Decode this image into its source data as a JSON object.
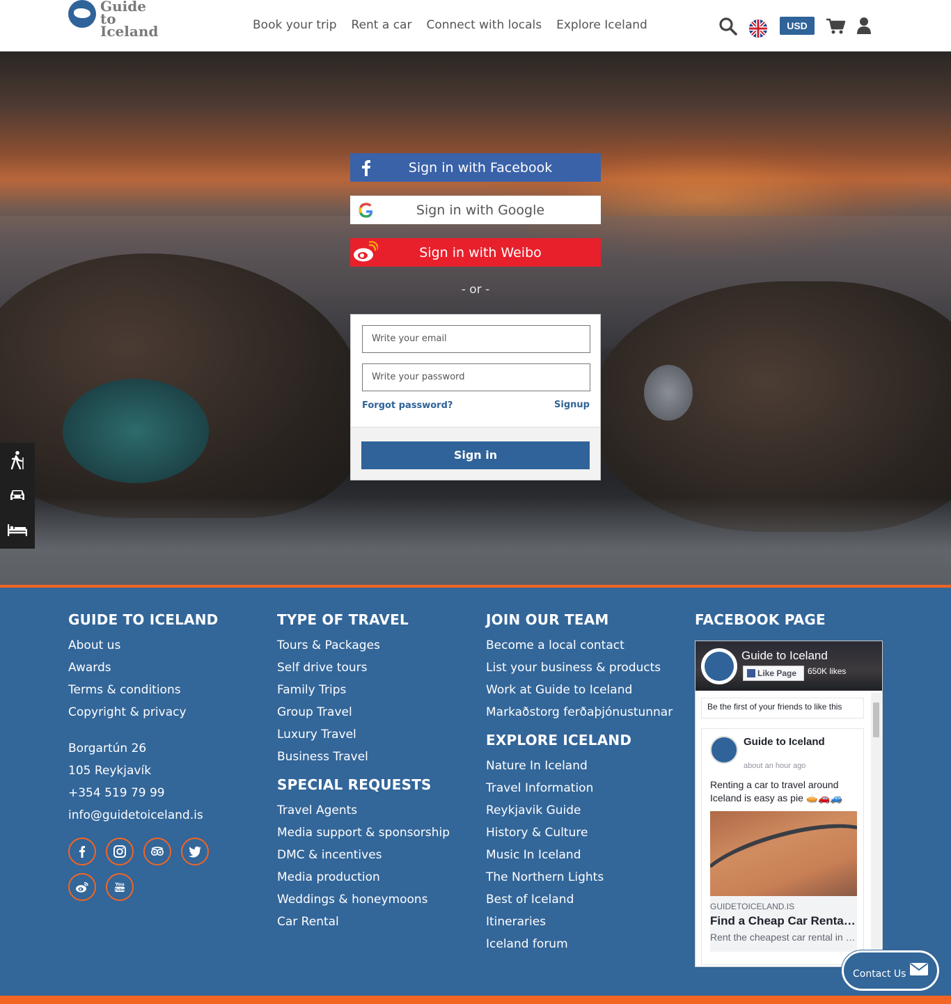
{
  "header": {
    "logo_text": "Guide to Iceland",
    "nav": [
      "Book your trip",
      "Rent a car",
      "Connect with locals",
      "Explore Iceland"
    ],
    "currency": "USD",
    "icons": [
      "search-icon",
      "uk-flag-icon",
      "cart-icon",
      "user-icon"
    ]
  },
  "login": {
    "facebook": "Sign in with Facebook",
    "google": "Sign in with Google",
    "weibo": "Sign in with Weibo",
    "or": "- or -",
    "email_placeholder": "Write your email",
    "password_placeholder": "Write your password",
    "forgot": "Forgot password?",
    "signup": "Signup",
    "signin": "Sign in"
  },
  "side_icons": [
    "hiking-icon",
    "car-icon",
    "bed-icon"
  ],
  "footer": {
    "col1": {
      "title": "GUIDE TO ICELAND",
      "links": [
        "About us",
        "Awards",
        "Terms & conditions",
        "Copyright & privacy"
      ],
      "address": [
        "Borgartún 26",
        "105 Reykjavík",
        "+354 519 79 99",
        "info@guidetoiceland.is"
      ]
    },
    "col2": {
      "title": "TYPE OF TRAVEL",
      "links": [
        "Tours & Packages",
        "Self drive tours",
        "Family Trips",
        "Group Travel",
        "Luxury Travel",
        "Business Travel"
      ],
      "title2": "SPECIAL REQUESTS",
      "links2": [
        "Travel Agents",
        "Media support & sponsorship",
        "DMC & incentives",
        "Media production",
        "Weddings & honeymoons",
        "Car Rental"
      ]
    },
    "col3": {
      "title": "JOIN OUR TEAM",
      "links": [
        "Become a local contact",
        "List your business & products",
        "Work at Guide to Iceland",
        "Markaðstorg ferðaþjónustunnar"
      ],
      "title2": "EXPLORE ICELAND",
      "links2": [
        "Nature In Iceland",
        "Travel Information",
        "Reykjavik Guide",
        "History & Culture",
        "Music In Iceland",
        "The Northern Lights",
        "Best of Iceland",
        "Itineraries",
        "Iceland forum"
      ]
    },
    "col4": {
      "title": "FACEBOOK PAGE",
      "page_name": "Guide to Iceland",
      "like_label": "Like Page",
      "likes": "650K likes",
      "first_friends": "Be the first of your friends to like this",
      "post_name": "Guide to Iceland",
      "post_time": "about an hour ago",
      "post_text": "Renting a car to travel around Iceland is easy as pie 🥧🚗🚙",
      "post_domain": "GUIDETOICELAND.IS",
      "post_title": "Find a Cheap Car Rental in Iceland",
      "post_desc": "Rent the cheapest car rental in Iceland"
    },
    "socials": [
      "facebook-icon",
      "instagram-icon",
      "tripadvisor-icon",
      "twitter-icon",
      "weibo-icon",
      "youtube-icon"
    ],
    "contact": "Contact Us"
  },
  "colors": {
    "brand": "#2f6399",
    "footer": "#336699",
    "accent": "#f26522",
    "facebook": "#3a62a8",
    "weibo": "#e8202c"
  }
}
